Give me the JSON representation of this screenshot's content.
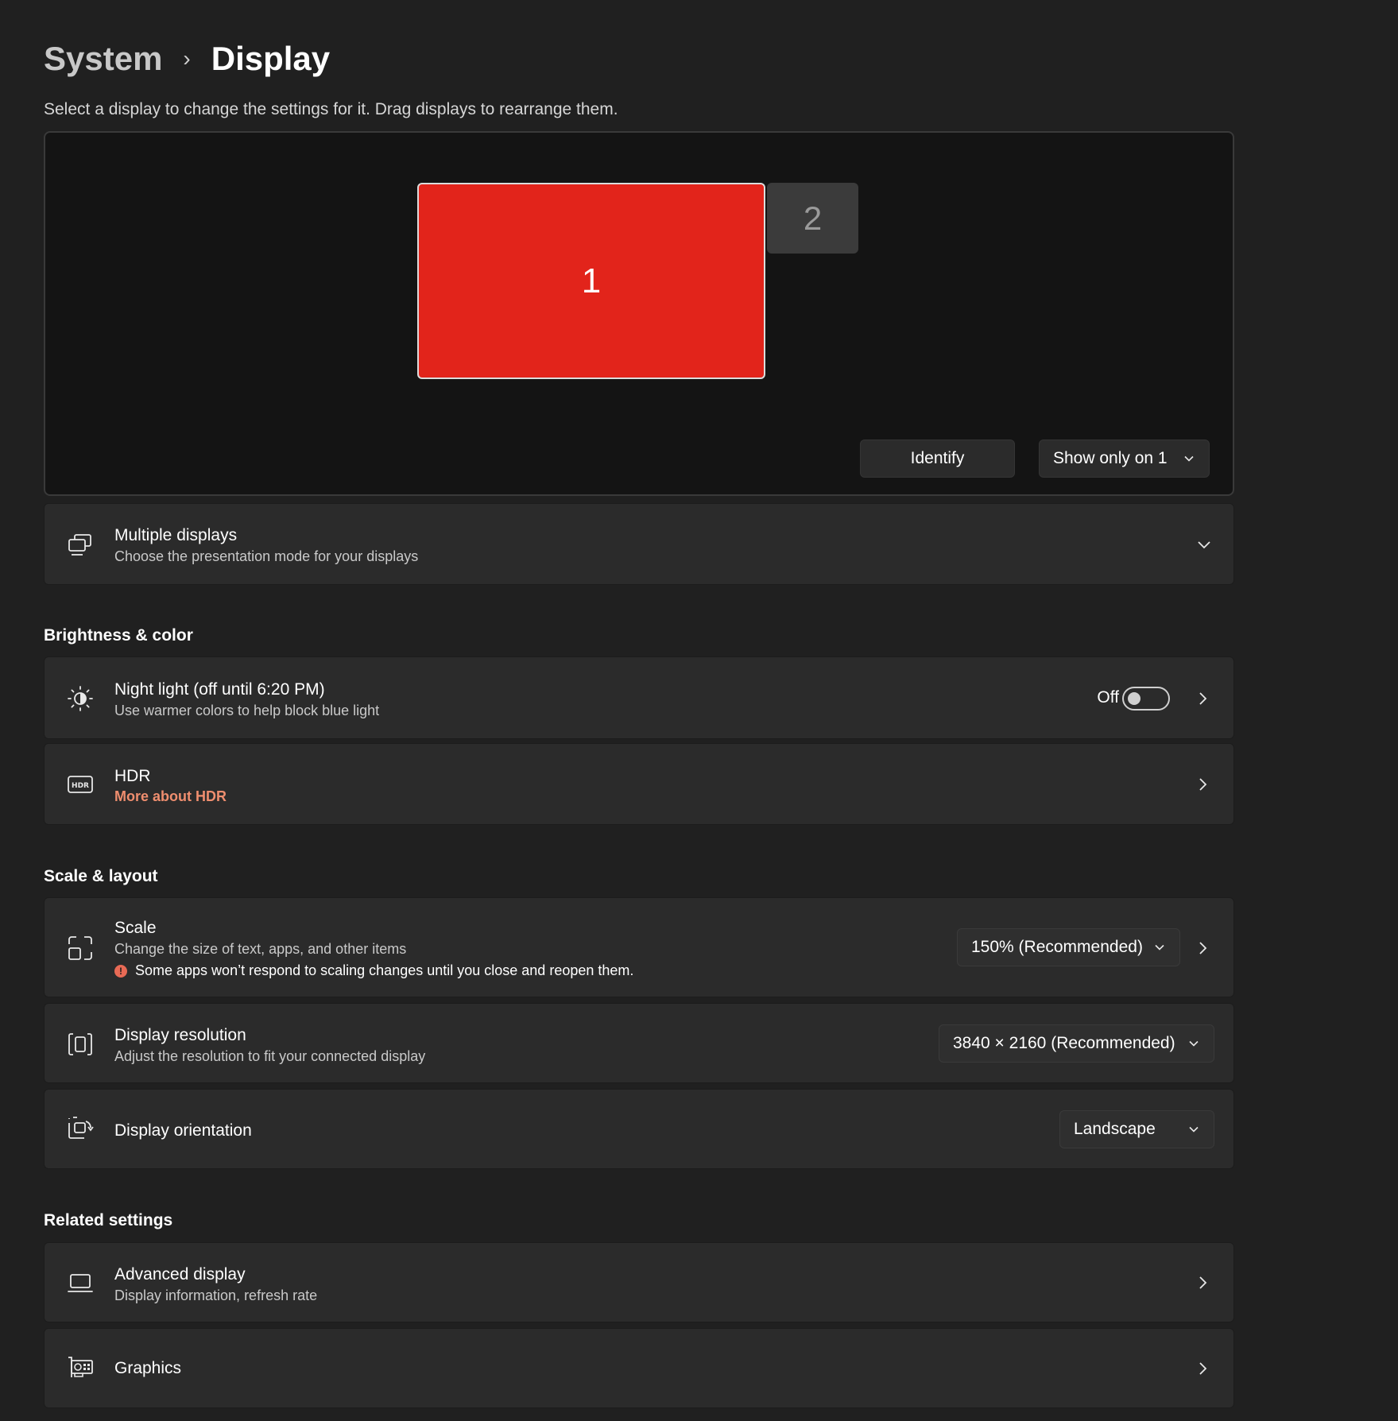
{
  "breadcrumb": {
    "parent": "System",
    "separator": "›",
    "current": "Display"
  },
  "instruction": "Select a display to change the settings for it. Drag displays to rearrange them.",
  "arrangement": {
    "monitors": [
      {
        "label": "1",
        "selected": true
      },
      {
        "label": "2",
        "selected": false
      }
    ],
    "identify_label": "Identify",
    "show_only_label": "Show only on 1"
  },
  "multiple_displays": {
    "title": "Multiple displays",
    "subtitle": "Choose the presentation mode for your displays"
  },
  "sections": {
    "brightness": "Brightness & color",
    "scale_layout": "Scale & layout",
    "related": "Related settings"
  },
  "night_light": {
    "title": "Night light (off until 6:20 PM)",
    "subtitle": "Use warmer colors to help block blue light",
    "state_label": "Off",
    "on": false
  },
  "hdr": {
    "title": "HDR",
    "link": "More about HDR"
  },
  "scale": {
    "title": "Scale",
    "subtitle": "Change the size of text, apps, and other items",
    "warning": "Some apps won’t respond to scaling changes until you close and reopen them.",
    "value": "150% (Recommended)"
  },
  "resolution": {
    "title": "Display resolution",
    "subtitle": "Adjust the resolution to fit your connected display",
    "value": "3840 × 2160 (Recommended)"
  },
  "orientation": {
    "title": "Display orientation",
    "value": "Landscape"
  },
  "advanced_display": {
    "title": "Advanced display",
    "subtitle": "Display information, refresh rate"
  },
  "graphics": {
    "title": "Graphics"
  },
  "colors": {
    "accent": "#e2241b",
    "link": "#ef8e6f",
    "background": "#202020",
    "card": "#2b2b2b"
  }
}
